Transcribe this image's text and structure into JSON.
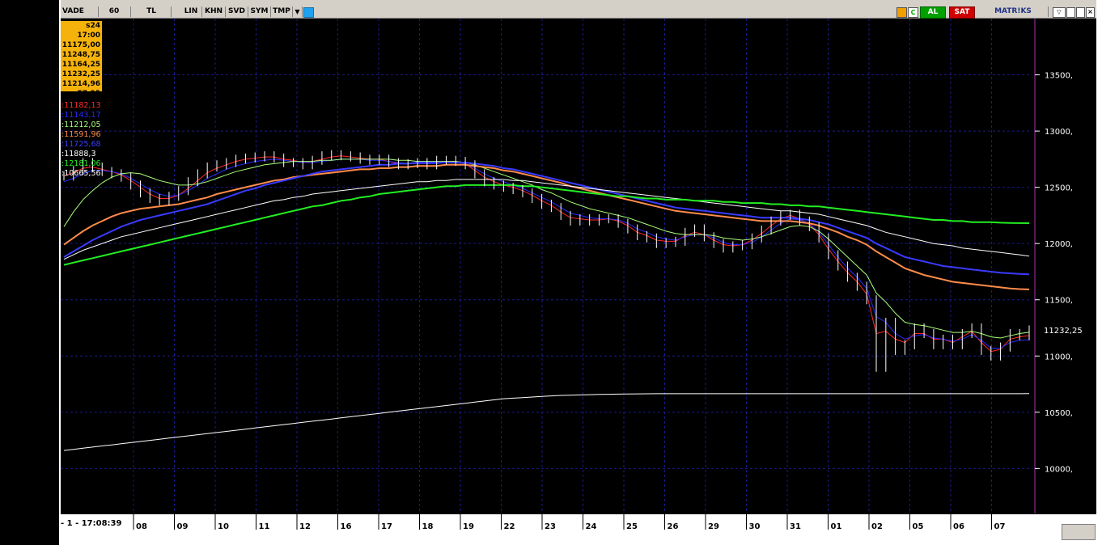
{
  "toolbar": {
    "items": [
      "VADE",
      "60",
      "TL",
      "LIN",
      "KHN",
      "SVD",
      "SYM",
      "TMP"
    ],
    "right_buttons": [
      "AL",
      "SAT"
    ],
    "brand": "MATR!KS",
    "colors": {
      "al": "#00a000",
      "sat": "#d00000",
      "bg": "#d4d0c8"
    }
  },
  "info_box": {
    "lines": [
      "s24 17:00",
      "11175,00",
      "11248,75",
      "11164,25",
      "11232,25",
      "11214,96",
      "57,25"
    ]
  },
  "ma_labels": [
    {
      "text": ":11182,13",
      "color": "#ff2a2a"
    },
    {
      "text": ":11143,17",
      "color": "#2a2aff"
    },
    {
      "text": ":11212,05",
      "color": "#a8ff7a"
    },
    {
      "text": ":11591,96",
      "color": "#ff8c4a"
    },
    {
      "text": ":11725,68",
      "color": "#3a3aff"
    },
    {
      "text": ":11888,3",
      "color": "#ffffff"
    },
    {
      "text": ":12181,06",
      "color": "#22ee22"
    },
    {
      "text": ":10665,56",
      "color": "#ffffff"
    }
  ],
  "status": {
    "time": "- 1 - 17:08:39"
  },
  "chart_data": {
    "type": "line",
    "x_tick_labels": [
      "08",
      "09",
      "10",
      "11",
      "12",
      "16",
      "17",
      "18",
      "19",
      "22",
      "23",
      "24",
      "25",
      "26",
      "29",
      "30",
      "31",
      "01",
      "02",
      "05",
      "06",
      "07"
    ],
    "y_tick_labels": [
      "13500,",
      "13000,",
      "12500,",
      "12000,",
      "11500,",
      "11000,",
      "10500,",
      "10000,"
    ],
    "y_ticks": [
      13500,
      13000,
      12500,
      12000,
      11500,
      11000,
      10500,
      10000
    ],
    "ylim": [
      9600,
      14000
    ],
    "last_price_label": "11232,25",
    "last_price": 11232.25,
    "grid": true,
    "price": [
      12600,
      12650,
      12720,
      12680,
      12640,
      12620,
      12590,
      12520,
      12450,
      12400,
      12380,
      12420,
      12470,
      12550,
      12620,
      12680,
      12700,
      12720,
      12750,
      12760,
      12770,
      12780,
      12760,
      12720,
      12720,
      12700,
      12740,
      12780,
      12790,
      12780,
      12770,
      12750,
      12740,
      12750,
      12720,
      12700,
      12710,
      12720,
      12700,
      12740,
      12740,
      12730,
      12700,
      12620,
      12550,
      12520,
      12500,
      12480,
      12450,
      12400,
      12350,
      12320,
      12250,
      12200,
      12220,
      12200,
      12220,
      12220,
      12180,
      12130,
      12070,
      12050,
      12000,
      12010,
      12020,
      12100,
      12130,
      12060,
      12000,
      11960,
      11980,
      11990,
      12050,
      12120,
      12200,
      12250,
      12260,
      12200,
      12150,
      12050,
      11900,
      11800,
      11700,
      11620,
      11500,
      10900,
      11300,
      11050,
      11100,
      11250,
      11200,
      11100,
      11150,
      11100,
      11200,
      11250,
      11050,
      11000,
      11080,
      11200,
      11180,
      11232
    ],
    "series": [
      {
        "name": "11182,13",
        "color": "#ff2a2a",
        "values": [
          12600,
          12630,
          12670,
          12680,
          12660,
          12640,
          12610,
          12560,
          12500,
          12440,
          12400,
          12400,
          12430,
          12490,
          12560,
          12630,
          12670,
          12700,
          12730,
          12750,
          12760,
          12770,
          12770,
          12750,
          12740,
          12720,
          12730,
          12750,
          12770,
          12780,
          12770,
          12760,
          12750,
          12750,
          12730,
          12710,
          12710,
          12720,
          12710,
          12720,
          12730,
          12730,
          12710,
          12650,
          12590,
          12550,
          12520,
          12500,
          12470,
          12430,
          12380,
          12340,
          12280,
          12230,
          12220,
          12210,
          12210,
          12220,
          12200,
          12160,
          12100,
          12070,
          12030,
          12020,
          12020,
          12070,
          12100,
          12080,
          12030,
          11990,
          11980,
          11990,
          12030,
          12090,
          12160,
          12220,
          12250,
          12220,
          12170,
          12080,
          11950,
          11840,
          11740,
          11660,
          11550,
          11200,
          11220,
          11150,
          11120,
          11200,
          11200,
          11150,
          11150,
          11120,
          11170,
          11220,
          11120,
          11040,
          11060,
          11150,
          11170,
          11182
        ]
      },
      {
        "name": "11143,17",
        "color": "#2a2aff",
        "values": [
          12550,
          12580,
          12620,
          12650,
          12650,
          12640,
          12620,
          12580,
          12530,
          12480,
          12440,
          12420,
          12430,
          12470,
          12520,
          12580,
          12620,
          12660,
          12690,
          12710,
          12730,
          12740,
          12750,
          12740,
          12730,
          12720,
          12720,
          12730,
          12740,
          12750,
          12750,
          12750,
          12740,
          12740,
          12730,
          12720,
          12710,
          12710,
          12710,
          12710,
          12720,
          12720,
          12710,
          12670,
          12620,
          12580,
          12550,
          12520,
          12490,
          12450,
          12410,
          12370,
          12320,
          12270,
          12250,
          12230,
          12220,
          12220,
          12210,
          12180,
          12130,
          12100,
          12060,
          12040,
          12030,
          12060,
          12080,
          12080,
          12050,
          12010,
          11990,
          11990,
          12010,
          12060,
          12120,
          12180,
          12220,
          12210,
          12180,
          12100,
          11990,
          11880,
          11780,
          11700,
          11600,
          11350,
          11300,
          11200,
          11150,
          11180,
          11190,
          11160,
          11150,
          11130,
          11150,
          11190,
          11140,
          11070,
          11070,
          11120,
          11140,
          11143
        ]
      },
      {
        "name": "11212,05",
        "color": "#a8ff7a",
        "values": [
          12150,
          12280,
          12390,
          12470,
          12540,
          12590,
          12620,
          12630,
          12620,
          12590,
          12560,
          12540,
          12520,
          12520,
          12530,
          12550,
          12580,
          12610,
          12640,
          12660,
          12680,
          12700,
          12710,
          12720,
          12730,
          12730,
          12730,
          12740,
          12740,
          12750,
          12750,
          12750,
          12750,
          12750,
          12750,
          12740,
          12740,
          12730,
          12730,
          12730,
          12730,
          12730,
          12720,
          12700,
          12670,
          12640,
          12610,
          12580,
          12550,
          12520,
          12480,
          12450,
          12410,
          12370,
          12340,
          12310,
          12290,
          12270,
          12250,
          12230,
          12200,
          12170,
          12140,
          12110,
          12090,
          12080,
          12080,
          12080,
          12070,
          12050,
          12040,
          12030,
          12040,
          12060,
          12090,
          12120,
          12150,
          12160,
          12150,
          12110,
          12040,
          11960,
          11880,
          11800,
          11720,
          11560,
          11480,
          11380,
          11300,
          11280,
          11270,
          11250,
          11230,
          11210,
          11210,
          11220,
          11200,
          11170,
          11160,
          11180,
          11200,
          11212
        ]
      },
      {
        "name": "11591,96",
        "color": "#ff8c4a",
        "values": [
          11990,
          12050,
          12110,
          12160,
          12200,
          12240,
          12270,
          12290,
          12310,
          12320,
          12330,
          12340,
          12350,
          12370,
          12390,
          12410,
          12440,
          12460,
          12480,
          12500,
          12520,
          12540,
          12560,
          12570,
          12590,
          12600,
          12610,
          12620,
          12630,
          12640,
          12650,
          12660,
          12660,
          12670,
          12670,
          12680,
          12680,
          12690,
          12690,
          12690,
          12700,
          12700,
          12700,
          12690,
          12680,
          12670,
          12650,
          12640,
          12620,
          12600,
          12580,
          12560,
          12540,
          12510,
          12490,
          12470,
          12450,
          12430,
          12410,
          12390,
          12370,
          12350,
          12330,
          12310,
          12290,
          12280,
          12270,
          12260,
          12250,
          12240,
          12230,
          12220,
          12210,
          12200,
          12200,
          12200,
          12200,
          12190,
          12180,
          12160,
          12130,
          12100,
          12060,
          12030,
          11990,
          11930,
          11880,
          11830,
          11780,
          11750,
          11720,
          11700,
          11680,
          11660,
          11650,
          11640,
          11630,
          11620,
          11610,
          11600,
          11595,
          11592
        ]
      },
      {
        "name": "11725,68",
        "color": "#3a3aff",
        "values": [
          11880,
          11930,
          11980,
          12030,
          12070,
          12110,
          12150,
          12180,
          12210,
          12230,
          12250,
          12270,
          12290,
          12310,
          12330,
          12350,
          12380,
          12410,
          12440,
          12470,
          12490,
          12520,
          12540,
          12560,
          12580,
          12600,
          12620,
          12640,
          12650,
          12660,
          12670,
          12680,
          12690,
          12700,
          12700,
          12710,
          12710,
          12720,
          12720,
          12720,
          12720,
          12720,
          12720,
          12710,
          12700,
          12690,
          12670,
          12660,
          12640,
          12620,
          12600,
          12580,
          12560,
          12540,
          12520,
          12500,
          12480,
          12460,
          12440,
          12420,
          12400,
          12380,
          12360,
          12340,
          12320,
          12310,
          12300,
          12290,
          12280,
          12270,
          12260,
          12250,
          12240,
          12230,
          12230,
          12230,
          12230,
          12220,
          12210,
          12190,
          12170,
          12140,
          12110,
          12080,
          12050,
          12000,
          11960,
          11920,
          11880,
          11860,
          11840,
          11820,
          11800,
          11790,
          11780,
          11770,
          11760,
          11750,
          11740,
          11735,
          11730,
          11726
        ]
      },
      {
        "name": "11888,3",
        "color": "#ffffff",
        "values": [
          11860,
          11900,
          11940,
          11970,
          12000,
          12030,
          12060,
          12080,
          12100,
          12120,
          12140,
          12160,
          12180,
          12200,
          12220,
          12240,
          12260,
          12280,
          12300,
          12320,
          12340,
          12360,
          12380,
          12390,
          12410,
          12420,
          12440,
          12450,
          12460,
          12470,
          12480,
          12490,
          12500,
          12510,
          12520,
          12530,
          12540,
          12550,
          12550,
          12560,
          12560,
          12570,
          12570,
          12570,
          12570,
          12570,
          12570,
          12560,
          12560,
          12550,
          12540,
          12530,
          12520,
          12510,
          12500,
          12490,
          12480,
          12470,
          12460,
          12450,
          12440,
          12430,
          12420,
          12410,
          12400,
          12390,
          12380,
          12370,
          12360,
          12350,
          12340,
          12330,
          12320,
          12310,
          12300,
          12290,
          12290,
          12280,
          12270,
          12260,
          12240,
          12220,
          12200,
          12180,
          12160,
          12130,
          12100,
          12080,
          12060,
          12040,
          12020,
          12000,
          11990,
          11980,
          11960,
          11950,
          11940,
          11930,
          11920,
          11910,
          11900,
          11888
        ]
      },
      {
        "name": "12181,06",
        "color": "#22ee22",
        "values": [
          11810,
          11830,
          11850,
          11870,
          11890,
          11910,
          11930,
          11950,
          11970,
          11990,
          12010,
          12030,
          12050,
          12070,
          12090,
          12110,
          12130,
          12150,
          12170,
          12190,
          12210,
          12230,
          12250,
          12270,
          12290,
          12310,
          12330,
          12340,
          12360,
          12380,
          12390,
          12410,
          12420,
          12440,
          12450,
          12460,
          12470,
          12480,
          12490,
          12500,
          12510,
          12510,
          12520,
          12520,
          12520,
          12520,
          12520,
          12520,
          12510,
          12510,
          12500,
          12490,
          12480,
          12470,
          12460,
          12450,
          12440,
          12430,
          12420,
          12420,
          12410,
          12400,
          12400,
          12390,
          12390,
          12390,
          12380,
          12380,
          12380,
          12370,
          12370,
          12360,
          12360,
          12360,
          12350,
          12350,
          12340,
          12340,
          12330,
          12330,
          12320,
          12310,
          12300,
          12290,
          12280,
          12270,
          12260,
          12250,
          12240,
          12230,
          12220,
          12210,
          12210,
          12200,
          12200,
          12190,
          12190,
          12190,
          12185,
          12183,
          12182,
          12181
        ]
      },
      {
        "name": "10665,56",
        "color": "#ffffff",
        "values": [
          10160,
          10170,
          10180,
          10190,
          10200,
          10210,
          10220,
          10230,
          10240,
          10250,
          10260,
          10270,
          10280,
          10290,
          10300,
          10310,
          10320,
          10330,
          10340,
          10350,
          10360,
          10370,
          10380,
          10390,
          10400,
          10410,
          10420,
          10430,
          10440,
          10450,
          10460,
          10470,
          10480,
          10490,
          10500,
          10510,
          10520,
          10530,
          10540,
          10550,
          10560,
          10570,
          10580,
          10590,
          10600,
          10610,
          10620,
          10625,
          10630,
          10635,
          10640,
          10645,
          10650,
          10652,
          10654,
          10656,
          10658,
          10660,
          10661,
          10662,
          10663,
          10664,
          10665,
          10665,
          10665,
          10665,
          10665,
          10665,
          10665,
          10665,
          10665,
          10665,
          10665,
          10665,
          10665,
          10665,
          10665,
          10665,
          10665,
          10665,
          10665,
          10665,
          10665,
          10665,
          10665,
          10665,
          10665,
          10665,
          10665,
          10665,
          10665,
          10665,
          10665,
          10665,
          10665,
          10665,
          10665,
          10665,
          10665,
          10665,
          10665,
          10666
        ]
      }
    ]
  }
}
